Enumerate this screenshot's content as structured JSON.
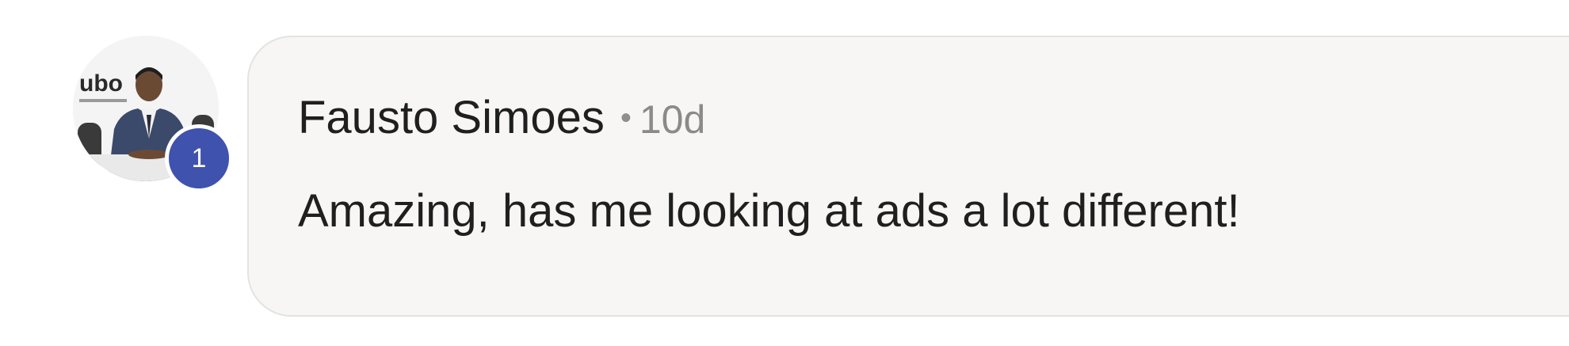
{
  "comment": {
    "author": "Fausto Simoes",
    "separator": "•",
    "time": "10d",
    "text": "Amazing, has me looking at ads a lot different!",
    "badge_count": "1",
    "avatar": {
      "icon": "profile-photo",
      "wall_text": "ubo"
    },
    "colors": {
      "badge": "#3f52ad",
      "bubble_bg": "#f7f6f4",
      "text": "#1f1f1f",
      "muted": "#8a8a8a"
    }
  }
}
